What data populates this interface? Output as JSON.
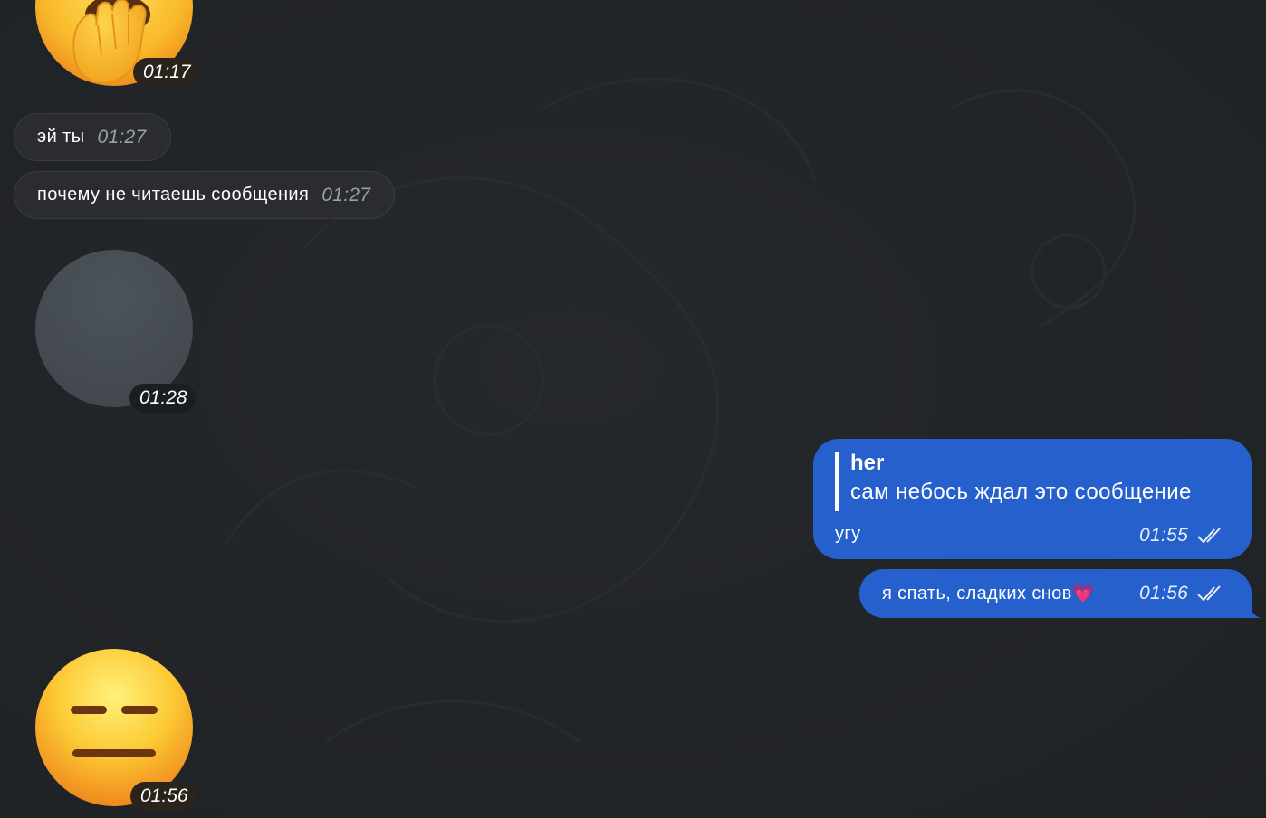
{
  "chat": {
    "messages": [
      {
        "type": "sticker",
        "direction": "incoming",
        "sticker": "face-with-hand-over-mouth",
        "time": "01:17"
      },
      {
        "type": "text",
        "direction": "incoming",
        "text": "эй ты",
        "time": "01:27"
      },
      {
        "type": "text",
        "direction": "incoming",
        "text": "почему не читаешь сообщения",
        "time": "01:27"
      },
      {
        "type": "sticker",
        "direction": "incoming",
        "sticker": "loading-placeholder",
        "time": "01:28"
      },
      {
        "type": "reply",
        "direction": "outgoing",
        "reply_author": "her",
        "reply_text": "сам небось ждал это сообщение",
        "text": "угу",
        "time": "01:55",
        "status": "read"
      },
      {
        "type": "text",
        "direction": "outgoing",
        "text": "я спать, сладких снов💗",
        "time": "01:56",
        "status": "read"
      },
      {
        "type": "sticker",
        "direction": "incoming",
        "sticker": "expressionless-face",
        "time": "01:56"
      }
    ]
  },
  "colors": {
    "background": "#222528",
    "incoming_bubble": "#2a2c2f",
    "outgoing_bubble": "#2660cc",
    "sticker_time_pill": "#2b241c"
  }
}
